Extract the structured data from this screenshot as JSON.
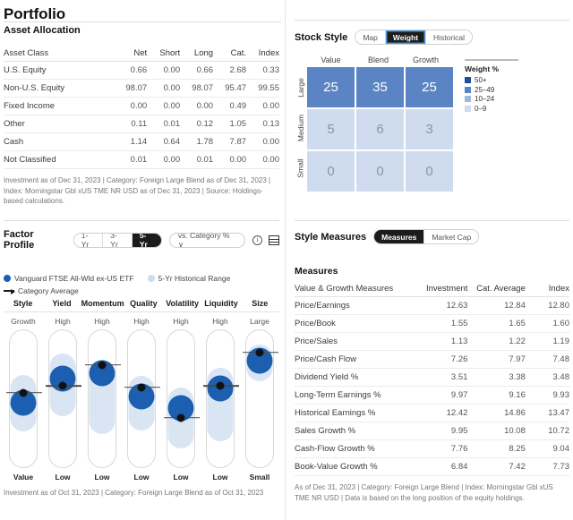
{
  "page": {
    "title": "Portfolio"
  },
  "asset_allocation": {
    "heading": "Asset Allocation",
    "columns": [
      "Asset Class",
      "Net",
      "Short",
      "Long",
      "Cat.",
      "Index"
    ],
    "rows": [
      {
        "label": "U.S. Equity",
        "net": "0.66",
        "short": "0.00",
        "long": "0.66",
        "cat": "2.68",
        "index": "0.33"
      },
      {
        "label": "Non-U.S. Equity",
        "net": "98.07",
        "short": "0.00",
        "long": "98.07",
        "cat": "95.47",
        "index": "99.55"
      },
      {
        "label": "Fixed Income",
        "net": "0.00",
        "short": "0.00",
        "long": "0.00",
        "cat": "0.49",
        "index": "0.00"
      },
      {
        "label": "Other",
        "net": "0.11",
        "short": "0.01",
        "long": "0.12",
        "cat": "1.05",
        "index": "0.13"
      },
      {
        "label": "Cash",
        "net": "1.14",
        "short": "0.64",
        "long": "1.78",
        "cat": "7.87",
        "index": "0.00"
      },
      {
        "label": "Not Classified",
        "net": "0.01",
        "short": "0.00",
        "long": "0.01",
        "cat": "0.00",
        "index": "0.00"
      }
    ],
    "footnote": "Investment as of Dec 31, 2023 | Category: Foreign Large Blend as of Dec 31, 2023 | Index: Morningstar Gbl xUS TME NR USD as of Dec 31, 2023 | Source: Holdings-based calculations."
  },
  "stock_style": {
    "heading": "Stock Style",
    "tabs": [
      {
        "label": "Map",
        "active": false
      },
      {
        "label": "Weight",
        "active": true
      },
      {
        "label": "Historical",
        "active": false
      }
    ],
    "col_labels": [
      "Value",
      "Blend",
      "Growth"
    ],
    "row_labels": [
      "Large",
      "Medium",
      "Small"
    ],
    "cells": [
      [
        {
          "value": "25",
          "band": "25-49"
        },
        {
          "value": "35",
          "band": "25-49"
        },
        {
          "value": "25",
          "band": "25-49"
        }
      ],
      [
        {
          "value": "5",
          "band": "0-9"
        },
        {
          "value": "6",
          "band": "0-9"
        },
        {
          "value": "3",
          "band": "0-9"
        }
      ],
      [
        {
          "value": "0",
          "band": "0-9"
        },
        {
          "value": "0",
          "band": "0-9"
        },
        {
          "value": "0",
          "band": "0-9"
        }
      ]
    ],
    "legend": {
      "title": "Weight %",
      "items": [
        {
          "label": "50+",
          "color": "#1f4e9c"
        },
        {
          "label": "25–49",
          "color": "#5b84c4"
        },
        {
          "label": "10–24",
          "color": "#9db8dd"
        },
        {
          "label": "0–9",
          "color": "#cfdcef"
        }
      ]
    },
    "band_colors": {
      "50+": "#1f4e9c",
      "25-49": "#5b84c4",
      "10-24": "#9db8dd",
      "0-9": "#cfdcef"
    },
    "band_text_colors": {
      "50+": "#ffffff",
      "25-49": "#ffffff",
      "10-24": "#555555",
      "0-9": "#8596ab"
    }
  },
  "factor_profile": {
    "heading": "Factor Profile",
    "period_tabs": [
      {
        "label": "1-Yr",
        "active": false
      },
      {
        "label": "3-Yr",
        "active": false
      },
      {
        "label": "5-Yr",
        "active": true
      }
    ],
    "compare_select": "vs. Category % ∨",
    "info_icon": "info-icon",
    "table_icon": "table-view-icon",
    "legend": [
      {
        "label": "Vanguard FTSE All-Wld ex-US ETF",
        "type": "dot",
        "color": "#1c5fb0"
      },
      {
        "label": "5-Yr Historical Range",
        "type": "dot",
        "color": "#cddcf0"
      },
      {
        "label": "Category Average",
        "type": "arrow",
        "color": "#1a1a1a"
      }
    ],
    "footnote": "Investment as of Oct 31, 2023 | Category: Foreign Large Blend as of Oct 31, 2023",
    "factors": [
      {
        "name": "Style",
        "top": "Growth",
        "bottom": "Value",
        "bubble_pct": 52,
        "cat_pct": 45,
        "range_top_pct": 32,
        "range_bottom_pct": 73
      },
      {
        "name": "Yield",
        "top": "High",
        "bottom": "Low",
        "bubble_pct": 35,
        "cat_pct": 40,
        "range_top_pct": 17,
        "range_bottom_pct": 62
      },
      {
        "name": "Momentum",
        "top": "High",
        "bottom": "Low",
        "bubble_pct": 31,
        "cat_pct": 25,
        "range_top_pct": 21,
        "range_bottom_pct": 75
      },
      {
        "name": "Quality",
        "top": "High",
        "bottom": "Low",
        "bubble_pct": 48,
        "cat_pct": 41,
        "range_top_pct": 33,
        "range_bottom_pct": 72
      },
      {
        "name": "Volatility",
        "top": "High",
        "bottom": "Low",
        "bubble_pct": 56,
        "cat_pct": 63,
        "range_top_pct": 41,
        "range_bottom_pct": 85
      },
      {
        "name": "Liquidity",
        "top": "High",
        "bottom": "Low",
        "bubble_pct": 42,
        "cat_pct": 40,
        "range_top_pct": 27,
        "range_bottom_pct": 80
      },
      {
        "name": "Size",
        "top": "Large",
        "bottom": "Small",
        "bubble_pct": 22,
        "cat_pct": 16,
        "range_top_pct": 10,
        "range_bottom_pct": 37
      }
    ]
  },
  "style_measures": {
    "heading": "Style Measures",
    "tabs": [
      {
        "label": "Measures",
        "active": true
      },
      {
        "label": "Market Cap",
        "active": false
      }
    ],
    "subtitle": "Measures",
    "columns": [
      "Value & Growth Measures",
      "Investment",
      "Cat. Average",
      "Index"
    ],
    "rows": [
      {
        "label": "Price/Earnings",
        "investment": "12.63",
        "cat_average": "12.84",
        "index": "12.80"
      },
      {
        "label": "Price/Book",
        "investment": "1.55",
        "cat_average": "1.65",
        "index": "1.60"
      },
      {
        "label": "Price/Sales",
        "investment": "1.13",
        "cat_average": "1.22",
        "index": "1.19"
      },
      {
        "label": "Price/Cash Flow",
        "investment": "7.26",
        "cat_average": "7.97",
        "index": "7.48"
      },
      {
        "label": "Dividend Yield %",
        "investment": "3.51",
        "cat_average": "3.38",
        "index": "3.48"
      },
      {
        "label": "Long-Term Earnings %",
        "investment": "9.97",
        "cat_average": "9.16",
        "index": "9.93"
      },
      {
        "label": "Historical Earnings %",
        "investment": "12.42",
        "cat_average": "14.86",
        "index": "13.47"
      },
      {
        "label": "Sales Growth %",
        "investment": "9.95",
        "cat_average": "10.08",
        "index": "10.72"
      },
      {
        "label": "Cash-Flow Growth %",
        "investment": "7.76",
        "cat_average": "8.25",
        "index": "9.04"
      },
      {
        "label": "Book-Value Growth %",
        "investment": "6.84",
        "cat_average": "7.42",
        "index": "7.73"
      }
    ],
    "footnote": "As of Dec 31, 2023 | Category: Foreign Large Blend | Index: Morningstar Gbl xUS TME NR USD | Data is based on the long position of the equity holdings."
  }
}
